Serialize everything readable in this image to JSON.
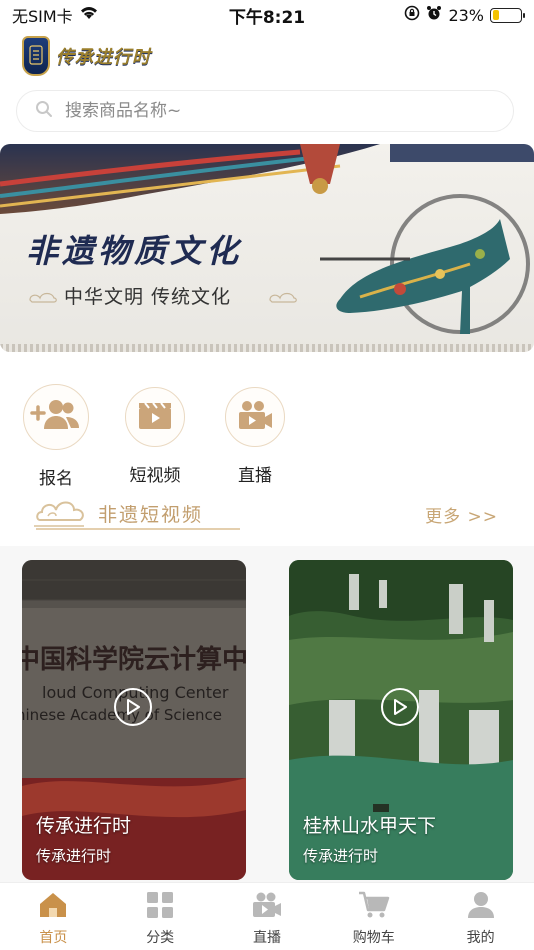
{
  "status_bar": {
    "carrier": "无SIM卡",
    "time": "下午8:21",
    "battery_percent": "23%",
    "battery_level": 0.23
  },
  "header": {
    "logo_text": "传承进行时",
    "logo_icon": "app-logo-icon"
  },
  "search": {
    "placeholder": "搜索商品名称~",
    "icon": "search-icon"
  },
  "banner": {
    "title": "非遗物质文化",
    "subtitle": "中华文明 传统文化"
  },
  "quick_actions": [
    {
      "label": "报名",
      "icon": "add-user-icon"
    },
    {
      "label": "短视频",
      "icon": "clapperboard-icon"
    },
    {
      "label": "直播",
      "icon": "video-camera-icon"
    }
  ],
  "section": {
    "title": "非遗短视频",
    "more": "更多 >>"
  },
  "videos": [
    {
      "title": "传承进行时",
      "subtitle": "传承进行时"
    },
    {
      "title": "桂林山水甲天下",
      "subtitle": "传承进行时"
    }
  ],
  "tabs": [
    {
      "label": "首页",
      "icon": "home-icon",
      "active": true
    },
    {
      "label": "分类",
      "icon": "grid-icon",
      "active": false
    },
    {
      "label": "直播",
      "icon": "video-camera-icon",
      "active": false
    },
    {
      "label": "购物车",
      "icon": "cart-icon",
      "active": false
    },
    {
      "label": "我的",
      "icon": "user-icon",
      "active": false
    }
  ],
  "colors": {
    "accent": "#c9914a",
    "section_gold": "#c29e6e",
    "banner_navy": "#1f2b52"
  }
}
